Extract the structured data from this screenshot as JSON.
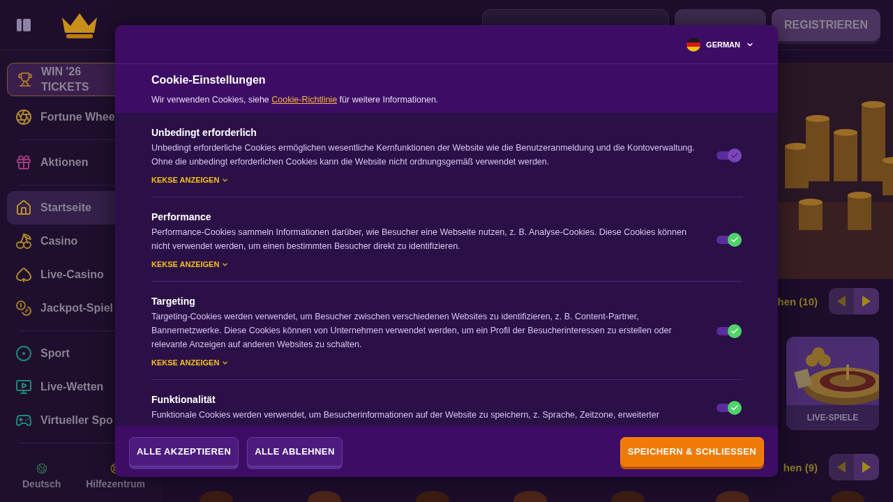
{
  "header": {
    "register": "REGISTRIEREN"
  },
  "sidebar": {
    "promo": "WIN '26 TICKETS",
    "groups": [
      [
        {
          "label": "Fortune Whee",
          "selected": false
        }
      ],
      [
        {
          "label": "Aktionen",
          "selected": false
        }
      ],
      [
        {
          "label": "Startseite",
          "selected": true
        },
        {
          "label": "Casino",
          "selected": false
        },
        {
          "label": "Live-Casino",
          "selected": false
        },
        {
          "label": "Jackpot-Spiel",
          "selected": false
        }
      ],
      [
        {
          "label": "Sport",
          "selected": false
        },
        {
          "label": "Live-Wetten",
          "selected": false
        },
        {
          "label": "Virtueller Spo",
          "selected": false
        }
      ]
    ],
    "footer": [
      "Deutsch",
      "Hilfezentrum"
    ]
  },
  "content": {
    "rows": [
      {
        "heading": "hen (10)"
      },
      {
        "heading": "hen (9)"
      }
    ],
    "card": {
      "label": "LIVE-SPIELE"
    }
  },
  "modal": {
    "language": "GERMAN",
    "title": "Cookie-Einstellungen",
    "intro_before": "Wir verwenden Cookies, siehe",
    "link": "Cookie-Richtlinie",
    "intro_after": "für weitere Informationen.",
    "sections": [
      {
        "title": "Unbedingt erforderlich",
        "text": "Unbedingt erforderliche Cookies ermöglichen wesentliche Kernfunktionen der Website wie die Benutzeranmeldung und die Kontoverwaltung. Ohne die unbedingt erforderlichen Cookies kann die Website nicht ordnungsgemäß verwendet werden.",
        "details": "KEKSE ANZEIGEN",
        "on": true,
        "disabled": true
      },
      {
        "title": "Performance",
        "text": "Performance-Cookies sammeln Informationen darüber, wie Besucher eine Webseite nutzen, z. B. Analyse-Cookies. Diese Cookies können nicht verwendet werden, um einen bestimmten Besucher direkt zu identifizieren.",
        "details": "KEKSE ANZEIGEN",
        "on": true,
        "disabled": false
      },
      {
        "title": "Targeting",
        "text": "Targeting-Cookies werden verwendet, um Besucher zwischen verschiedenen Websites zu identifizieren, z. B. Content-Partner, Bannernetzwerke. Diese Cookies können von Unternehmen verwendet werden, um ein Profil der Besucherinteressen zu erstellen oder relevante Anzeigen auf anderen Websites zu schalten.",
        "details": "KEKSE ANZEIGEN",
        "on": true,
        "disabled": false
      },
      {
        "title": "Funktionalität",
        "text": "Funktionale Cookies werden verwendet, um Besucherinformationen auf der Website zu speichern, z. Sprache, Zeitzone, erweiterter",
        "on": true,
        "disabled": false
      }
    ],
    "buttons": {
      "accept": "ALLE AKZEPTIEREN",
      "reject": "ALLE ABLEHNEN",
      "save": "SPEICHERN & SCHLIESSEN"
    }
  }
}
